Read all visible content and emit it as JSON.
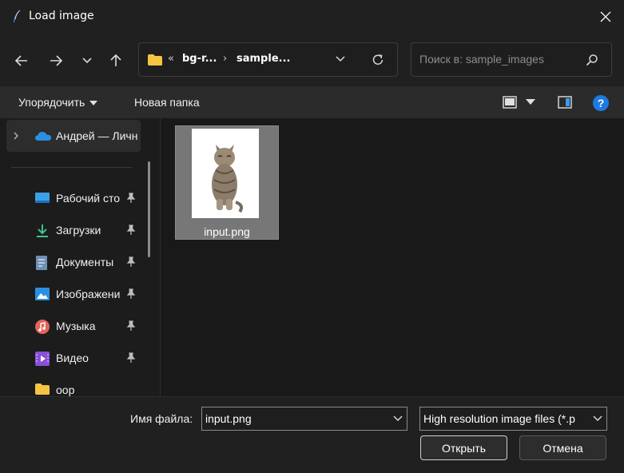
{
  "window": {
    "title": "Load image",
    "title_icon": "feather-icon",
    "close_icon": "close-icon"
  },
  "nav": {
    "back_icon": "arrow-left-icon",
    "forward_icon": "arrow-right-icon",
    "recent_icon": "chevron-down-icon",
    "up_icon": "arrow-up-icon"
  },
  "address": {
    "overflow": "«",
    "crumbs": [
      "bg-r...",
      "sample..."
    ],
    "separator": "›"
  },
  "search": {
    "placeholder": "Поиск в: sample_images"
  },
  "commands": {
    "organize": "Упорядочить",
    "new_folder": "Новая папка"
  },
  "sidebar": {
    "top_item": "Андрей — Личн",
    "items": [
      {
        "label": "Рабочий сто",
        "icon": "desktop-icon",
        "pinned": true
      },
      {
        "label": "Загрузки",
        "icon": "download-icon",
        "pinned": true
      },
      {
        "label": "Документы",
        "icon": "document-icon",
        "pinned": true
      },
      {
        "label": "Изображени",
        "icon": "pictures-icon",
        "pinned": true
      },
      {
        "label": "Музыка",
        "icon": "music-icon",
        "pinned": true
      },
      {
        "label": "Видео",
        "icon": "video-icon",
        "pinned": true
      },
      {
        "label": "oop",
        "icon": "folder-icon",
        "pinned": false
      }
    ]
  },
  "files": [
    {
      "name": "input.png",
      "selected": true
    }
  ],
  "footer": {
    "filename_label": "Имя файла:",
    "filename_value": "input.png",
    "filter_value": "High resolution image files (*.p",
    "open_button": "Открыть",
    "cancel_button": "Отмена"
  },
  "colors": {
    "accent_help": "#1f7ae0",
    "folder": "#f4c542",
    "onedrive": "#2a8fe0",
    "selected_tile": "#777777"
  }
}
